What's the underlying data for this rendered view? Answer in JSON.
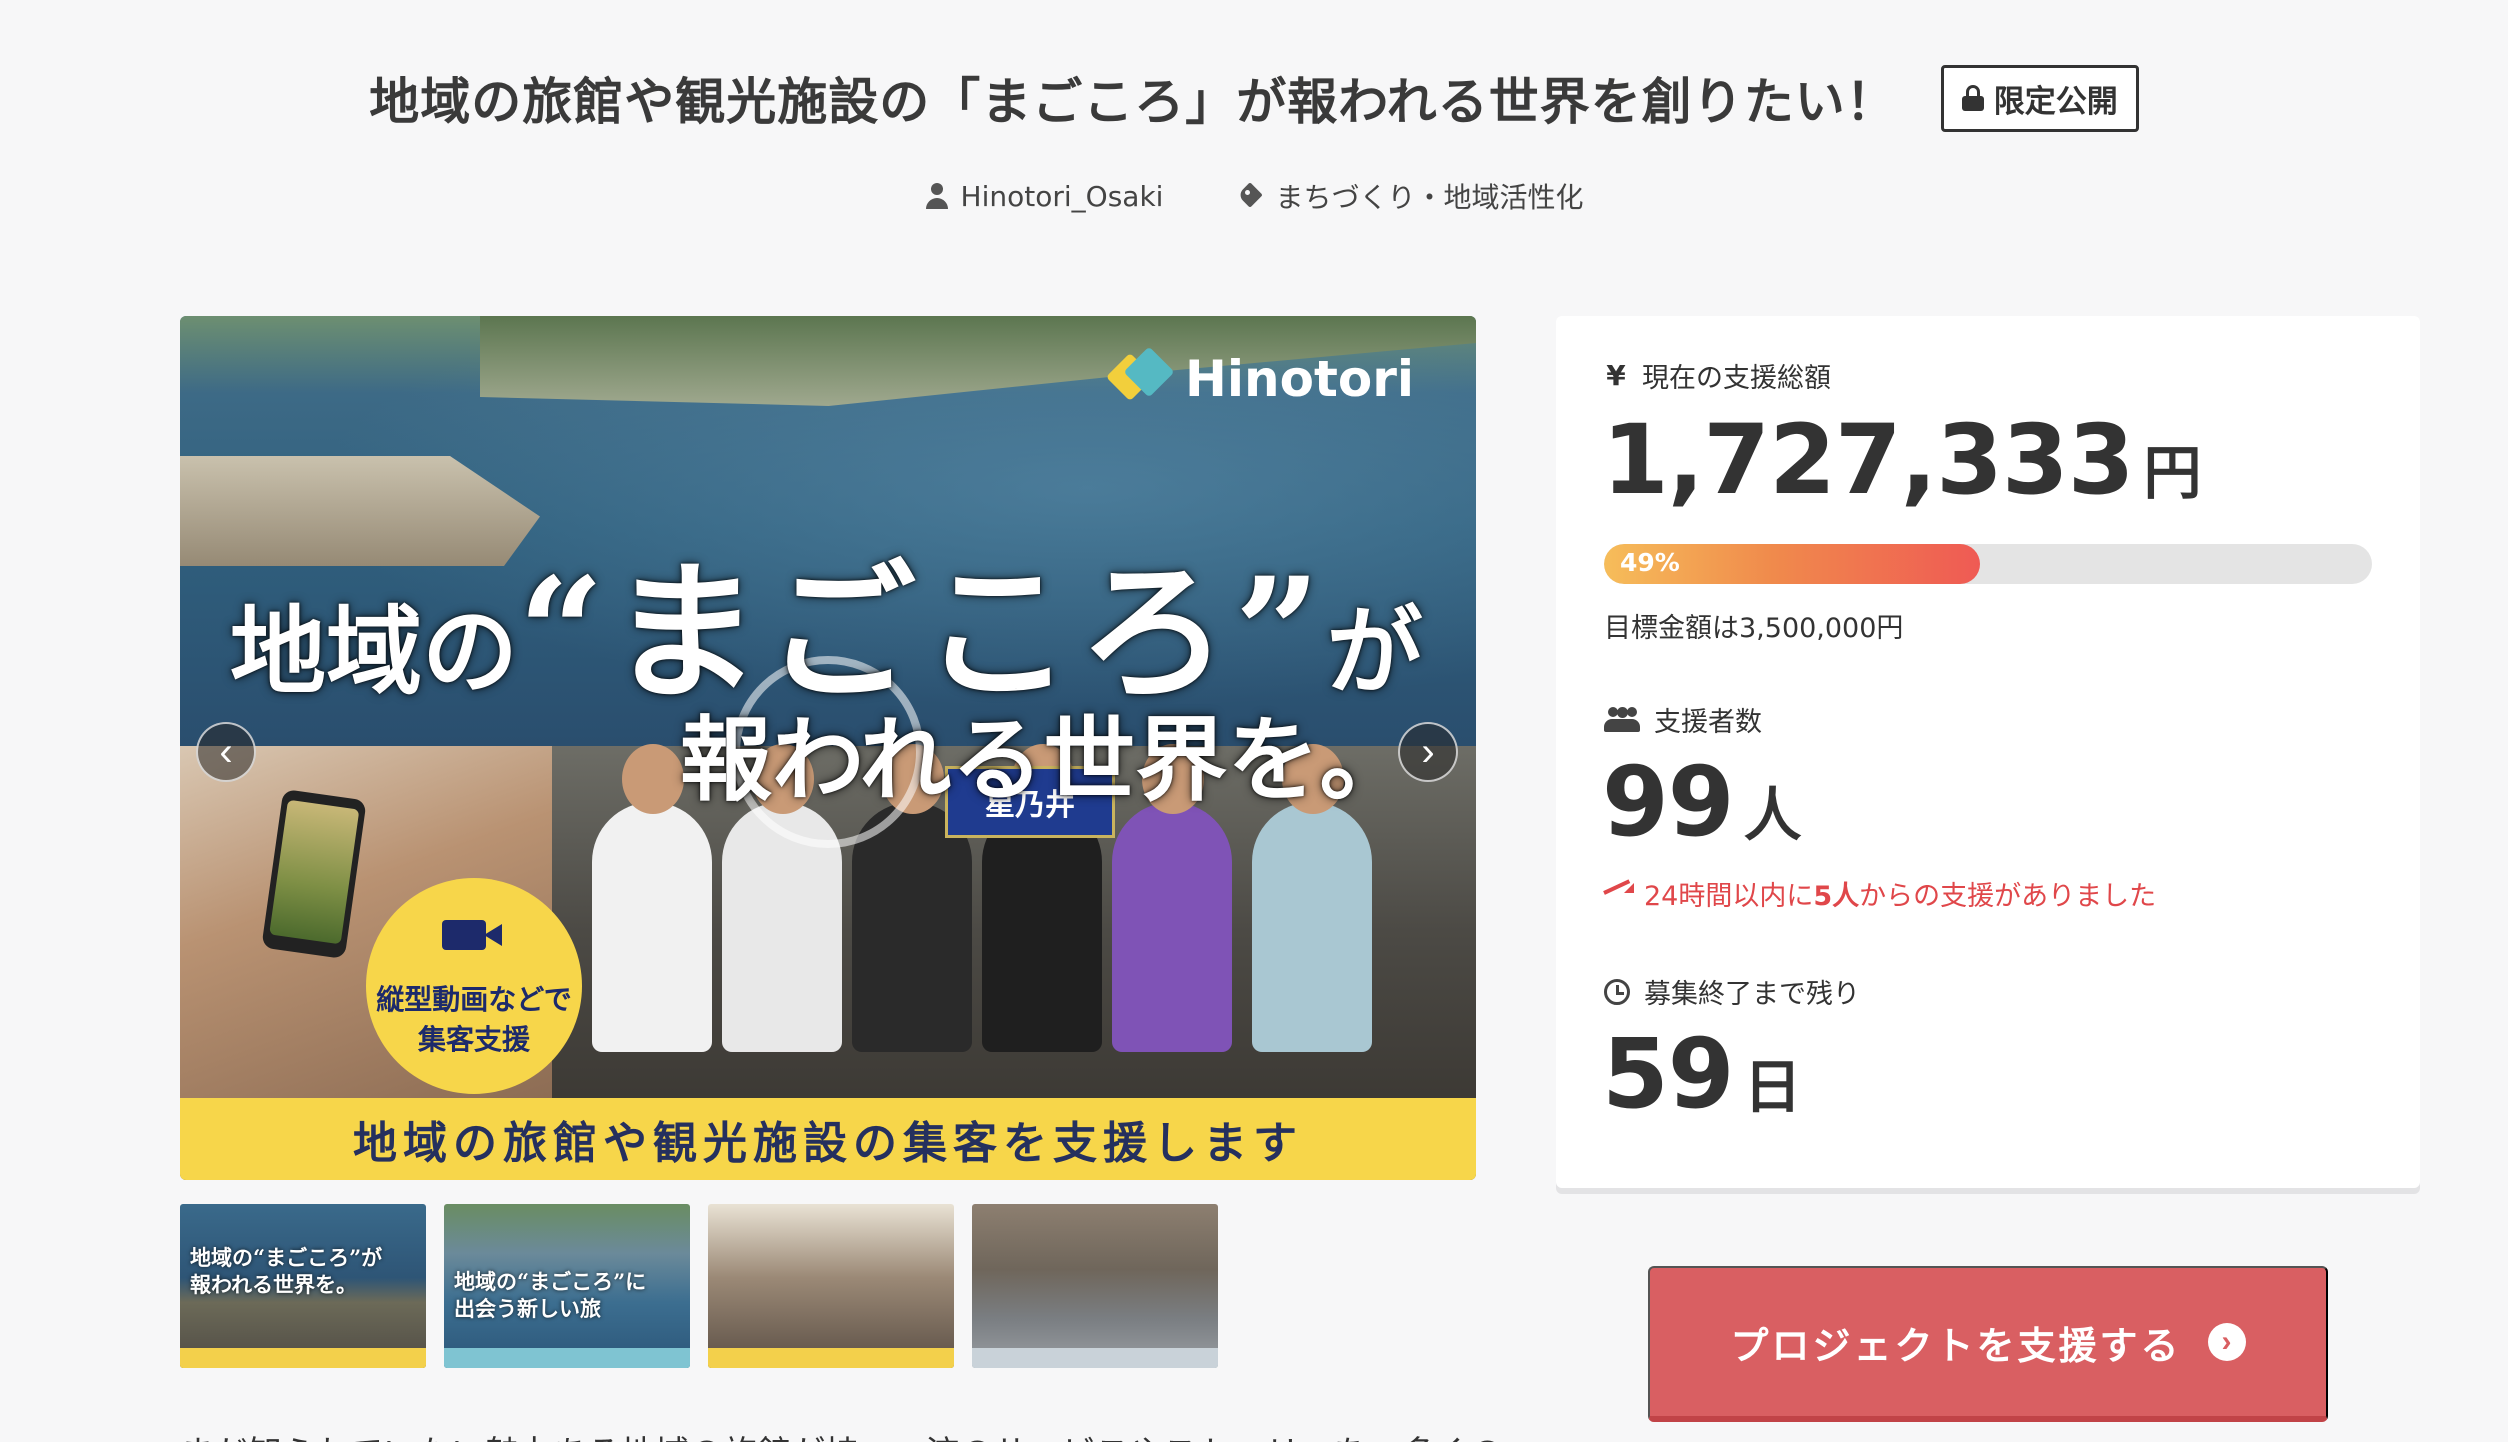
{
  "header": {
    "title": "地域の旅館や観光施設の「まごころ」が報われる世界を創りたい！",
    "badge": "限定公開",
    "author": "Hinotori_Osaki",
    "category": "まちづくり・地域活性化"
  },
  "hero": {
    "logo_text": "Hinotori",
    "headline_part1": "地域の",
    "headline_part2": "“まごころ”",
    "headline_part3": "が",
    "headline_line2": "報われる世界を。",
    "sign_text": "星乃井",
    "badge_line1": "縦型動画などで",
    "badge_line2": "集客支援",
    "bottom_band": "地域の旅館や観光施設の集客を支援します",
    "prev_glyph": "‹",
    "next_glyph": "›"
  },
  "thumbnails": [
    {
      "text_line1": "地域の“まごころ”が",
      "text_line2": "報われる世界を。"
    },
    {
      "text_line1": "地域の“まごころ”に",
      "text_line2": "出会う新しい旅"
    },
    {
      "text_line1": "",
      "text_line2": ""
    },
    {
      "text_line1": "",
      "text_line2": ""
    }
  ],
  "stats": {
    "total_label": "現在の支援総額",
    "total_value": "1,727,333",
    "total_unit": "円",
    "progress_percent": 49,
    "progress_label": "49%",
    "goal_text": "目標金額は3,500,000円",
    "supporters_label": "支援者数",
    "supporters_value": "99",
    "supporters_unit": "人",
    "recent_prefix": "24時間以内に",
    "recent_count": "5人",
    "recent_suffix": "からの支援がありました",
    "remaining_label": "募集終了まで残り",
    "remaining_value": "59",
    "remaining_unit": "日",
    "yen_glyph": "¥"
  },
  "cta": {
    "label": "プロジェクトを支援する",
    "arrow_glyph": "›"
  },
  "body": {
    "intro_text": "まだ知られていない魅力ある地域の旅館が持つ、流のサービスやストーリーを、多くの"
  },
  "colors": {
    "accent": "#d95f62",
    "progress_start": "#f6bd5a",
    "progress_end": "#ef5a54",
    "alert": "#e0474a",
    "band_yellow": "#f7d64a"
  }
}
